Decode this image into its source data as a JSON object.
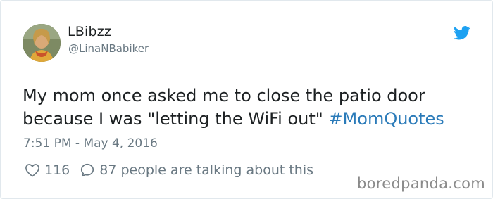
{
  "author": {
    "display_name": "LBibzz",
    "handle": "@LinaNBabiker"
  },
  "tweet": {
    "line1": "My mom once asked me to close the patio door",
    "line2_text": "because I was \"letting the WiFi out\" ",
    "hashtag": "#MomQuotes",
    "timestamp": "7:51 PM - May 4, 2016"
  },
  "actions": {
    "like_count": "116",
    "reply_text": "87 people are talking about this"
  },
  "watermark": "boredpanda.com",
  "colors": {
    "link": "#2b7bb9",
    "twitter_blue": "#1da1f2",
    "secondary_text": "#697882",
    "primary_text": "#1c2022"
  },
  "icons": {
    "brand": "twitter-bird-icon",
    "like": "heart-icon",
    "reply": "speech-bubble-icon"
  }
}
